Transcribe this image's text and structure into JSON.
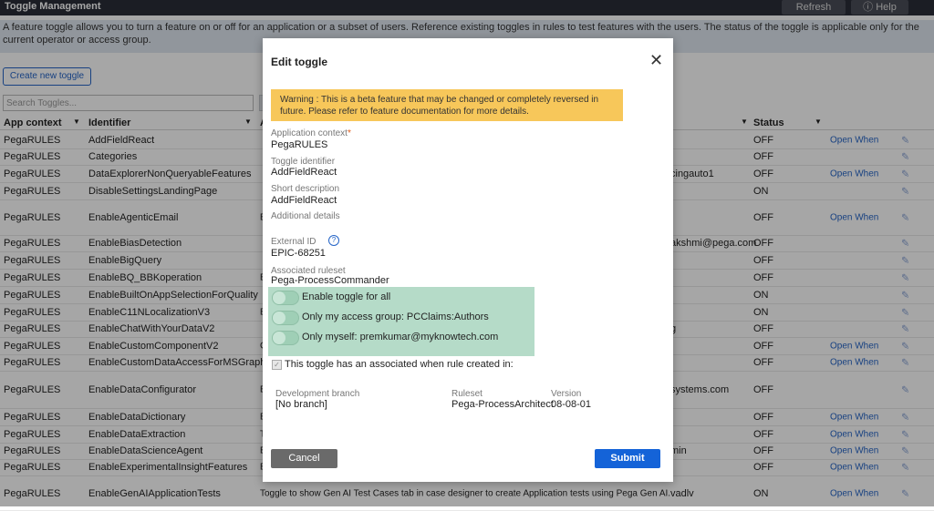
{
  "header": {
    "title": "Toggle Management",
    "refresh_label": "Refresh",
    "help_label": "Help",
    "help_icon": "question-circle-icon"
  },
  "info_text": "A feature toggle allows you to turn a feature on or off for an application or a subset of users. Reference existing toggles in rules to test features with the users. The status of the toggle is applicable only for the current operator or access group.",
  "create_label": "Create new toggle",
  "search_placeholder": "Search Toggles...",
  "table": {
    "headers": {
      "ctx": "App context",
      "id": "Identifier",
      "desc": "A",
      "status": "Status"
    },
    "rows": [
      {
        "ctx": "PegaRULES",
        "id": "AddFieldReact",
        "desc": "",
        "user": "",
        "status": "OFF",
        "open": "Open When"
      },
      {
        "ctx": "PegaRULES",
        "id": "Categories",
        "desc": "",
        "user": "",
        "status": "OFF",
        "open": ""
      },
      {
        "ctx": "PegaRULES",
        "id": "DataExplorerNonQueryableFeatures",
        "desc": "",
        "user": "cingauto1",
        "status": "OFF",
        "open": "Open When"
      },
      {
        "ctx": "PegaRULES",
        "id": "DisableSettingsLandingPage",
        "desc": "",
        "user": "",
        "status": "ON",
        "open": ""
      },
      {
        "ctx": "PegaRULES",
        "id": "EnableAgenticEmail",
        "desc": "E",
        "user": "",
        "status": "OFF",
        "open": "Open When"
      },
      {
        "ctx": "PegaRULES",
        "id": "EnableBiasDetection",
        "desc": "",
        "user": "akshmi@pega.com",
        "status": "OFF",
        "open": ""
      },
      {
        "ctx": "PegaRULES",
        "id": "EnableBigQuery",
        "desc": "",
        "user": "",
        "status": "OFF",
        "open": ""
      },
      {
        "ctx": "PegaRULES",
        "id": "EnableBQ_BBKoperation",
        "desc": "E",
        "user": "",
        "status": "OFF",
        "open": ""
      },
      {
        "ctx": "PegaRULES",
        "id": "EnableBuiltOnAppSelectionForQuality",
        "desc": "",
        "user": "",
        "status": "ON",
        "open": ""
      },
      {
        "ctx": "PegaRULES",
        "id": "EnableC11NLocalizationV3",
        "desc": "E",
        "user": "",
        "status": "ON",
        "open": ""
      },
      {
        "ctx": "PegaRULES",
        "id": "EnableChatWithYourDataV2",
        "desc": "",
        "user": "g",
        "status": "OFF",
        "open": ""
      },
      {
        "ctx": "PegaRULES",
        "id": "EnableCustomComponentV2",
        "desc": "C",
        "user": "",
        "status": "OFF",
        "open": "Open When"
      },
      {
        "ctx": "PegaRULES",
        "id": "EnableCustomDataAccessForMSGraph",
        "desc": "",
        "user": "",
        "status": "OFF",
        "open": "Open When"
      },
      {
        "ctx": "PegaRULES",
        "id": "EnableDataConfigurator",
        "desc": "E",
        "user": "systems.com",
        "status": "OFF",
        "open": ""
      },
      {
        "ctx": "PegaRULES",
        "id": "EnableDataDictionary",
        "desc": "E",
        "user": "",
        "status": "OFF",
        "open": "Open When"
      },
      {
        "ctx": "PegaRULES",
        "id": "EnableDataExtraction",
        "desc": "T",
        "user": "",
        "status": "OFF",
        "open": "Open When"
      },
      {
        "ctx": "PegaRULES",
        "id": "EnableDataScienceAgent",
        "desc": "E",
        "user": "min",
        "status": "OFF",
        "open": "Open When"
      },
      {
        "ctx": "PegaRULES",
        "id": "EnableExperimentalInsightFeatures",
        "desc": "E",
        "user": "",
        "status": "OFF",
        "open": "Open When"
      },
      {
        "ctx": "PegaRULES",
        "id": "EnableGenAIApplicationTests",
        "desc": "Toggle to show Gen AI Test Cases tab in case designer to create Application tests using Pega Gen AI.",
        "user": "vadlv",
        "status": "ON",
        "open": "Open When"
      }
    ]
  },
  "modal": {
    "title": "Edit toggle",
    "close_icon": "close-icon",
    "warning": "Warning : This is a beta feature that may be changed or completely reversed in future. Please refer to feature documentation for more details.",
    "app_context_label": "Application context",
    "app_context_required": "*",
    "app_context": "PegaRULES",
    "identifier_label": "Toggle identifier",
    "identifier": "AddFieldReact",
    "short_desc_label": "Short description",
    "short_desc": "AddFieldReact",
    "additional_label": "Additional details",
    "external_id_label": "External ID",
    "external_id_icon": "question-circle-icon",
    "external_id": "EPIC-68251",
    "ruleset_label": "Associated ruleset",
    "ruleset": "Pega-ProcessCommander",
    "toggles": [
      {
        "label": "Enable toggle for all",
        "on": false
      },
      {
        "label": "Only my access group: PCClaims:Authors",
        "on": false
      },
      {
        "label": "Only myself: premkumar@myknowtech.com",
        "on": false
      }
    ],
    "when_rule_label": "This toggle has an associated when rule created in:",
    "when_rule_checked": true,
    "dev_branch_label": "Development branch",
    "dev_branch": "[No branch]",
    "ruleset_col_label": "Ruleset",
    "ruleset_col": "Pega-ProcessArchitect",
    "version_label": "Version",
    "version": "08-08-01",
    "cancel_label": "Cancel",
    "submit_label": "Submit"
  },
  "colors": {
    "accent": "#1463d8",
    "warning": "#f7c75a",
    "toggle_highlight": "#b5dbc8",
    "topbar": "#2a2d38"
  }
}
